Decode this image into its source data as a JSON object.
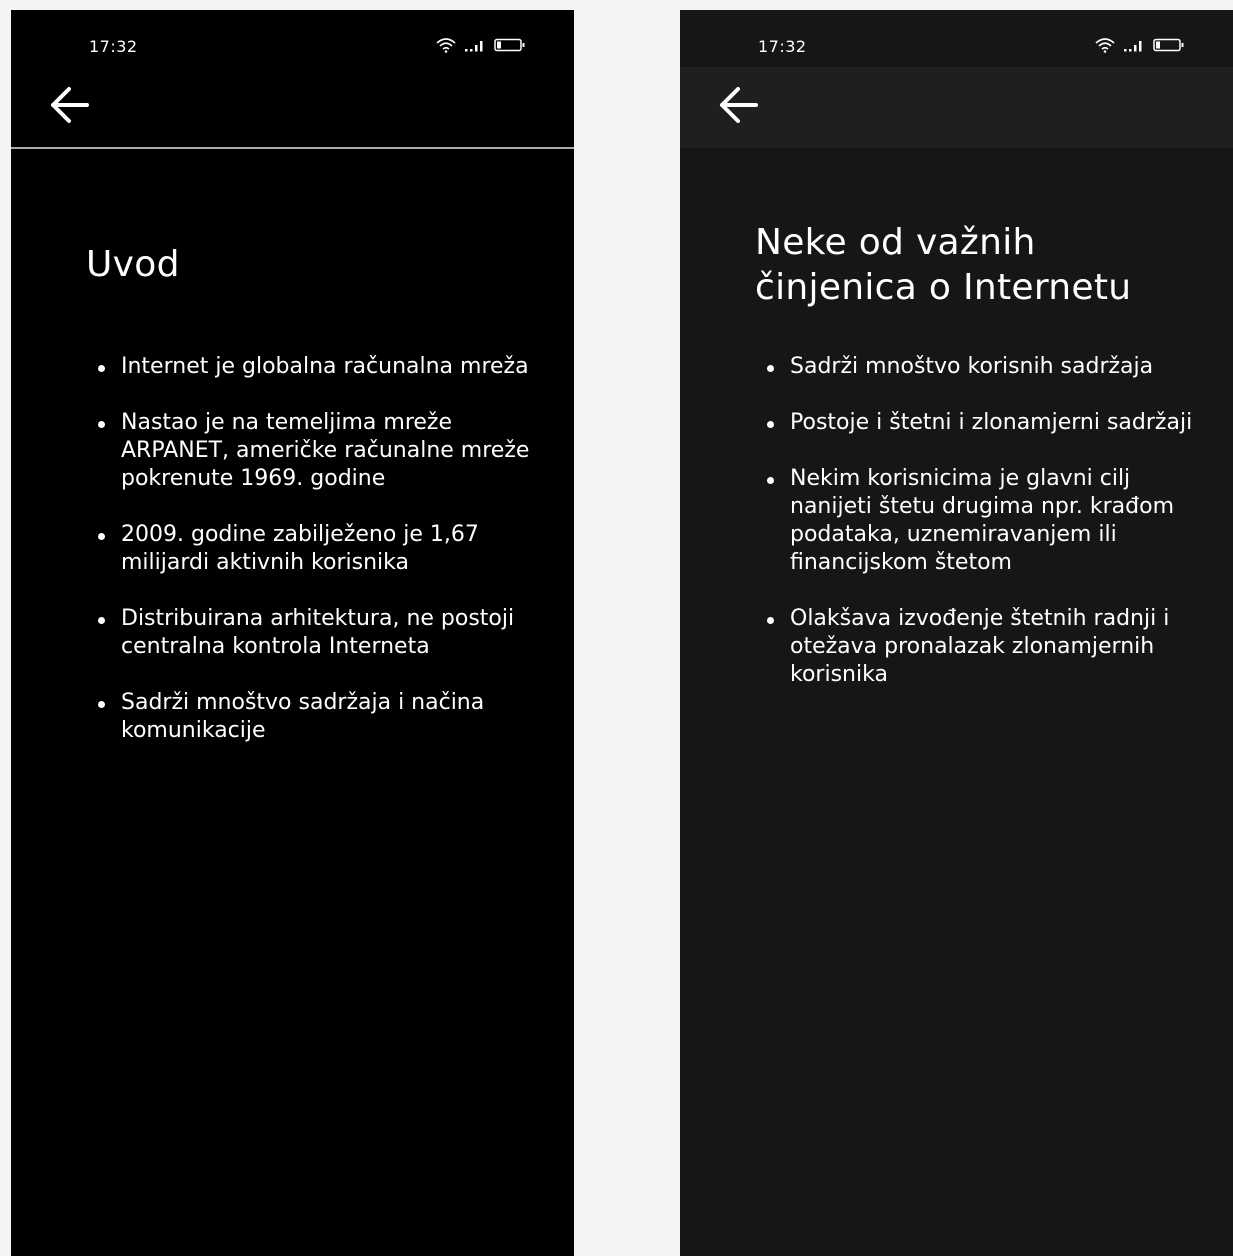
{
  "screens": [
    {
      "status_time": "17:32",
      "title": "Uvod",
      "bullets": [
        "Internet je globalna računalna mreža",
        "Nastao je na temeljima mreže ARPANET, američke računalne mreže pokrenute 1969. godine",
        "2009. godine zabilježeno je 1,67 milijardi aktivnih korisnika",
        "Distribuirana arhitektura, ne postoji centralna kontrola Interneta",
        "Sadrži mnoštvo sadržaja i načina komunikacije"
      ]
    },
    {
      "status_time": "17:32",
      "title": "Neke od važnih činjenica o Internetu",
      "bullets": [
        "Sadrži mnoštvo korisnih sadržaja",
        "Postoje i štetni i zlonamjerni sadržaji",
        "Nekim korisnicima je glavni cilj nanijeti štetu drugima npr. krađom podataka, uznemiravanjem ili financijskom štetom",
        "Olakšava izvođenje štetnih radnji i otežava pronalazak zlonamjernih korisnika"
      ]
    }
  ],
  "icons": {
    "back": "arrow-left-icon",
    "wifi": "wifi-icon",
    "signal": "signal-icon",
    "battery": "battery-icon"
  },
  "colors": {
    "left_background": "#000000",
    "right_background": "#161616",
    "right_app_bar": "#1f1f1f",
    "text": "#ffffff",
    "page_background": "#f4f4f4"
  }
}
